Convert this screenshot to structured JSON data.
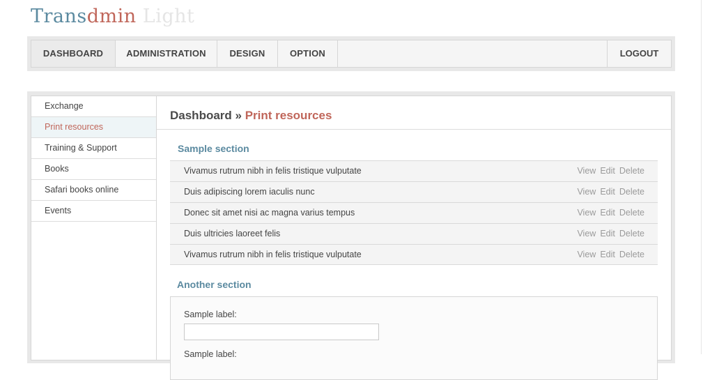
{
  "logo": {
    "part1": "Trans",
    "part2": "dmin",
    "part3": " Light"
  },
  "nav": {
    "items": [
      "DASHBOARD",
      "ADMINISTRATION",
      "DESIGN",
      "OPTION"
    ],
    "logout": "LOGOUT"
  },
  "sidebar": {
    "items": [
      "Exchange",
      "Print resources",
      "Training & Support",
      "Books",
      "Safari books online",
      "Events"
    ],
    "active_index": 1
  },
  "breadcrumb": {
    "root": "Dashboard",
    "separator": " » ",
    "current": "Print resources"
  },
  "sample_section": {
    "title": "Sample section",
    "rows": [
      {
        "title": "Vivamus rutrum nibh in felis tristique vulputate",
        "view": "View",
        "edit": "Edit",
        "delete": "Delete"
      },
      {
        "title": "Duis adipiscing lorem iaculis nunc",
        "view": "View",
        "edit": "Edit",
        "delete": "Delete"
      },
      {
        "title": "Donec sit amet nisi ac magna varius tempus",
        "view": "View",
        "edit": "Edit",
        "delete": "Delete"
      },
      {
        "title": "Duis ultricies laoreet felis",
        "view": "View",
        "edit": "Edit",
        "delete": "Delete"
      },
      {
        "title": "Vivamus rutrum nibh in felis tristique vulputate",
        "view": "View",
        "edit": "Edit",
        "delete": "Delete"
      }
    ]
  },
  "another_section": {
    "title": "Another section",
    "label1": "Sample label:",
    "input1_value": "",
    "label2": "Sample label:"
  },
  "colors": {
    "accent_blue": "#5b8aa0",
    "accent_red": "#c0665a"
  }
}
